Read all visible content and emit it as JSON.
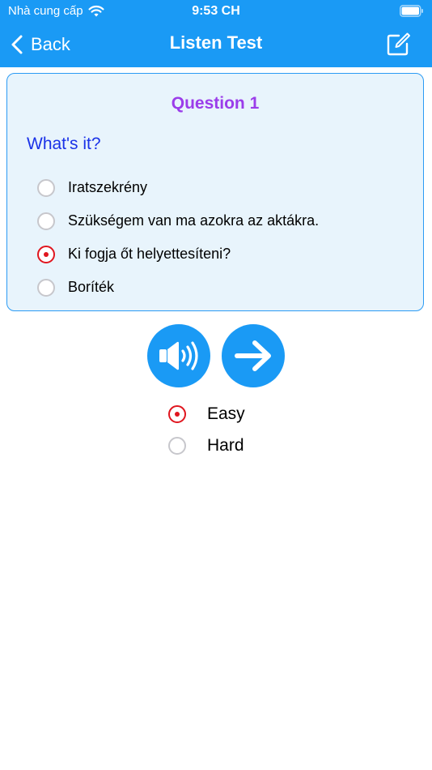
{
  "status_bar": {
    "carrier": "Nhà cung cấp",
    "time": "9:53 CH"
  },
  "nav": {
    "back_label": "Back",
    "title": "Listen Test"
  },
  "question": {
    "title": "Question 1",
    "prompt": "What's it?",
    "options": [
      {
        "label": "Iratszekrény",
        "selected": false
      },
      {
        "label": "Szükségem van ma azokra az aktákra.",
        "selected": false
      },
      {
        "label": "Ki fogja őt helyettesíteni?",
        "selected": true
      },
      {
        "label": "Boríték",
        "selected": false
      }
    ]
  },
  "actions": {
    "sound_icon": "speaker-icon",
    "next_icon": "arrow-right-icon"
  },
  "difficulty": {
    "options": [
      {
        "label": "Easy",
        "selected": true
      },
      {
        "label": "Hard",
        "selected": false
      }
    ]
  },
  "colors": {
    "primary": "#1a9af5",
    "card_bg": "#e8f4fc",
    "card_border": "#2b9bf4",
    "question_title": "#9b3dea",
    "prompt": "#1a32e8",
    "radio_selected": "#e0161f",
    "radio_unselected": "#c7c7cc"
  }
}
